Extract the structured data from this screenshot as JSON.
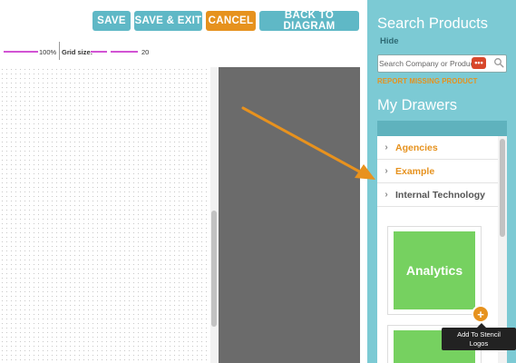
{
  "toolbar": {
    "save_label": "SAVE",
    "save_exit_label": "SAVE & EXIT",
    "cancel_label": "CANCEL",
    "back_label": "BACK TO DIAGRAM"
  },
  "zoom": {
    "value": "100%",
    "grid_label": "Grid size:",
    "grid_value": "20"
  },
  "sidebar": {
    "search_title": "Search Products",
    "hide_label": "Hide",
    "search_placeholder": "Search Company or Product",
    "badge_text": "•••",
    "report_link": "REPORT MISSING PRODUCT",
    "drawers_title": "My Drawers",
    "drawers": [
      {
        "label": "Agencies"
      },
      {
        "label": "Example"
      },
      {
        "label": "Internal Technology"
      }
    ],
    "cards": [
      {
        "label": "Analytics"
      }
    ],
    "add_button_label": "+",
    "tooltip_line1": "Add To Stencil",
    "tooltip_line2": "Logos"
  },
  "colors": {
    "teal_button": "#5fb8c6",
    "orange_button": "#e6921e",
    "sidebar_bg": "#7ccad4",
    "card_green": "#76d160",
    "canvas_dark": "#6b6b6b",
    "slider_magenta": "#d254d4"
  },
  "annotation": {
    "arrow_color": "#e8921e"
  }
}
